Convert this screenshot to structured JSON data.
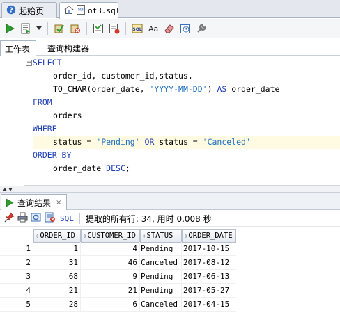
{
  "doc_tabs": [
    {
      "label": "起始页",
      "icon": "home-icon",
      "active": false
    },
    {
      "label": "ot3.sql",
      "icon": "sql-file-icon",
      "active": true
    }
  ],
  "toolbar": {
    "buttons": [
      {
        "name": "run-statement-button",
        "icon": "run-icon"
      },
      {
        "name": "run-script-button",
        "icon": "script-icon"
      },
      {
        "name": "dropdown-button",
        "icon": "chevron-down-icon"
      },
      {
        "name": "commit-button",
        "icon": "commit-icon"
      },
      {
        "name": "rollback-button",
        "icon": "rollback-icon"
      },
      {
        "name": "explain-plan-button",
        "icon": "explain-icon"
      },
      {
        "name": "autotrace-button",
        "icon": "autotrace-icon"
      },
      {
        "name": "sql-tuning-button",
        "icon": "sql-tuning-icon"
      },
      {
        "name": "format-button",
        "icon": "case-icon"
      },
      {
        "name": "clear-button",
        "icon": "eraser-icon"
      },
      {
        "name": "history-button",
        "icon": "history-icon"
      },
      {
        "name": "tools-button",
        "icon": "wrench-icon"
      }
    ]
  },
  "sub_tabs": {
    "worksheet": "工作表",
    "query_builder": "查询构建器"
  },
  "editor": {
    "fold_marker": "−",
    "lines": [
      {
        "kw": "SELECT"
      },
      {
        "indent": true,
        "text": "order_id, customer_id,status,"
      },
      {
        "indent": true,
        "fn": "TO_CHAR(order_date, ",
        "str": "'YYYY-MM-DD'",
        "mid": ")",
        "kw2": " AS",
        "tail": " order_date"
      },
      {
        "kw": "FROM"
      },
      {
        "indent": true,
        "text": "orders"
      },
      {
        "kw": "WHERE"
      },
      {
        "indent": true,
        "highlight": true,
        "a": "status = ",
        "s1": "'Pending'",
        "k": " OR",
        "b": " status = ",
        "s2": "'Canceled'"
      },
      {
        "kw": "ORDER BY"
      },
      {
        "indent": true,
        "a": "order_date ",
        "k": "DESC",
        "b": ";"
      }
    ]
  },
  "results": {
    "tab_label": "查询结果",
    "tab_close": "×",
    "sql_label": "SQL",
    "status_text": "提取的所有行: 34, 用时 0.008 秒",
    "columns": [
      "ORDER_ID",
      "CUSTOMER_ID",
      "STATUS",
      "ORDER_DATE"
    ],
    "rows": [
      {
        "n": "1",
        "order_id": "1",
        "customer_id": "4",
        "status": "Pending",
        "order_date": "2017-10-15"
      },
      {
        "n": "2",
        "order_id": "31",
        "customer_id": "46",
        "status": "Canceled",
        "order_date": "2017-08-12"
      },
      {
        "n": "3",
        "order_id": "68",
        "customer_id": "9",
        "status": "Pending",
        "order_date": "2017-06-13"
      },
      {
        "n": "4",
        "order_id": "21",
        "customer_id": "21",
        "status": "Pending",
        "order_date": "2017-05-27"
      },
      {
        "n": "5",
        "order_id": "28",
        "customer_id": "6",
        "status": "Canceled",
        "order_date": "2017-04-15"
      }
    ]
  },
  "colors": {
    "keyword": "#1f3fb5",
    "string": "#1c6ec0",
    "highlight_line": "#fffbe3"
  }
}
